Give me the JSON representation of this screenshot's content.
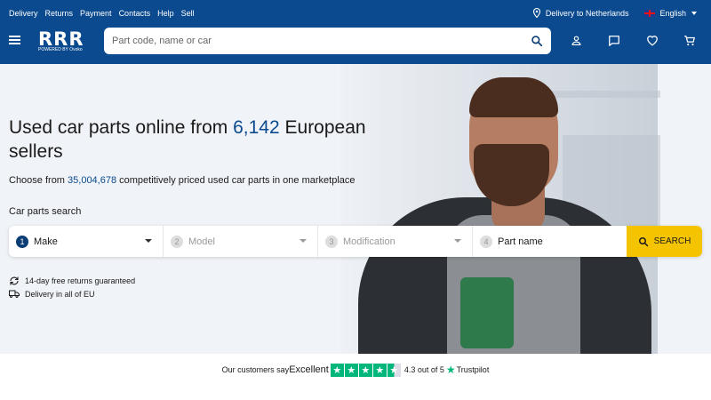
{
  "top_links": [
    "Delivery",
    "Returns",
    "Payment",
    "Contacts",
    "Help",
    "Sell"
  ],
  "delivery_to": "Delivery to Netherlands",
  "language": "English",
  "logo": {
    "name": "RRR",
    "powered": "POWERED BY Ovoko"
  },
  "search": {
    "placeholder": "Part code, name or car"
  },
  "headline": {
    "pre": "Used car parts online from ",
    "num": "6,142",
    "post": " European sellers"
  },
  "subline": {
    "pre": "Choose from ",
    "num": "35,004,678",
    "post": " competitively priced used car parts in one marketplace"
  },
  "car_parts_label": "Car parts search",
  "selectors": [
    {
      "step": "1",
      "label": "Make"
    },
    {
      "step": "2",
      "label": "Model"
    },
    {
      "step": "3",
      "label": "Modification"
    },
    {
      "step": "4",
      "label": "Part name"
    }
  ],
  "search_button": "SEARCH",
  "features": [
    "14-day free returns guaranteed",
    "Delivery in all of EU"
  ],
  "trust": {
    "prefix": "Our customers say",
    "rating_word": "Excellent",
    "rating": 4.3,
    "score": "4.3 out of 5",
    "brand": "Trustpilot"
  },
  "colors": {
    "primary": "#0b4a8f",
    "accent": "#f5c400",
    "trustpilot": "#00b67a"
  }
}
